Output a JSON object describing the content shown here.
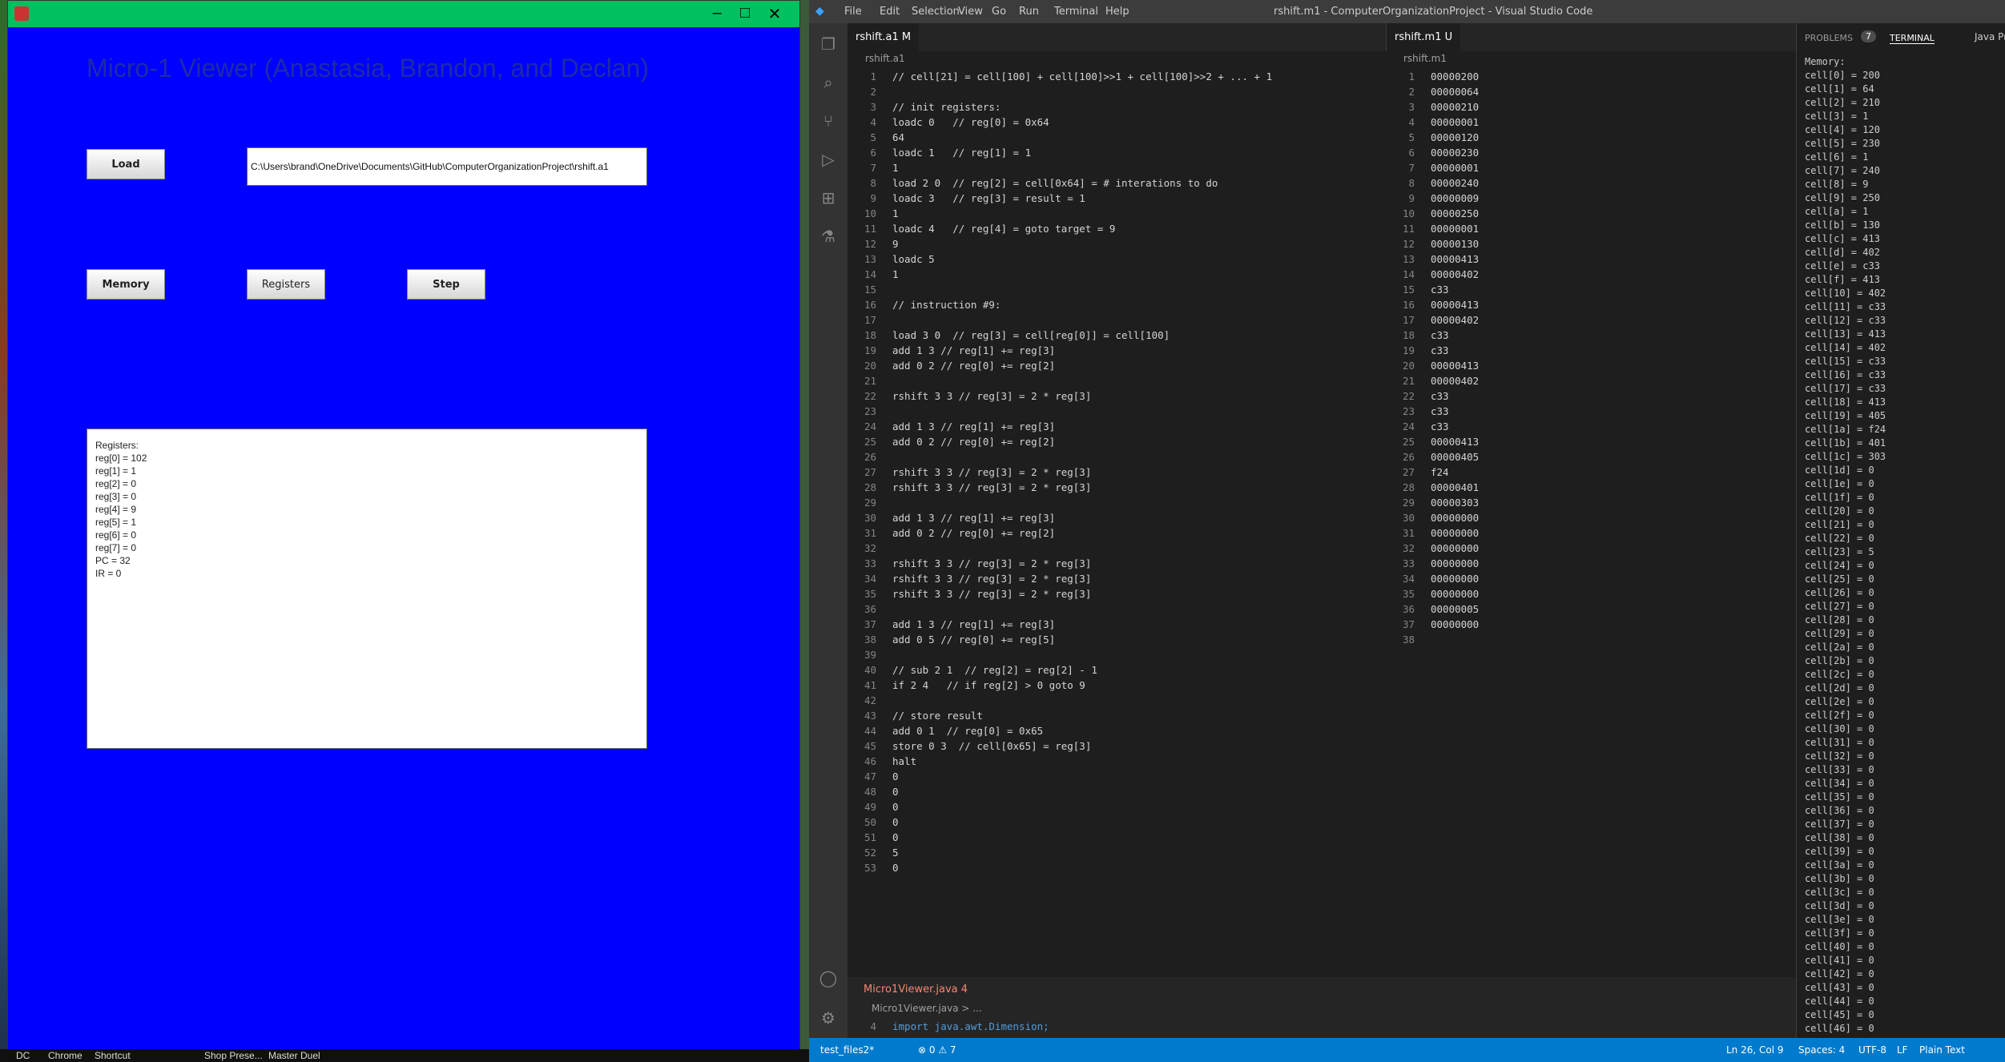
{
  "java_window": {
    "heading": "Micro-1 Viewer (Anastasia, Brandon, and Declan)",
    "buttons": {
      "load": "Load",
      "memory": "Memory",
      "registers": "Registers",
      "step": "Step"
    },
    "path_field": "C:\\Users\\brand\\OneDrive\\Documents\\GitHub\\ComputerOrganizationProject\\rshift.a1",
    "registers_text": [
      "Registers:",
      "reg[0] = 102",
      "reg[1] = 1",
      "reg[2] = 0",
      "reg[3] = 0",
      "reg[4] = 9",
      "reg[5] = 1",
      "reg[6] = 0",
      "reg[7] = 0",
      "PC = 32",
      "IR = 0"
    ]
  },
  "taskbar": [
    "DC",
    "Chrome",
    "Shortcut",
    "Shop Prese...",
    "Master Duel"
  ],
  "vscode": {
    "menu": [
      "File",
      "Edit",
      "Selection",
      "View",
      "Go",
      "Run",
      "Terminal",
      "Help"
    ],
    "title": "rshift.m1 - ComputerOrganizationProject - Visual Studio Code",
    "left_tab": "rshift.a1  M",
    "left_breadcrumb": "rshift.a1",
    "left_code": [
      "// cell[21] = cell[100] + cell[100]>>1 + cell[100]>>2 + ... + 1",
      "",
      "// init registers:",
      "loadc 0   // reg[0] = 0x64",
      "64",
      "loadc 1   // reg[1] = 1",
      "1",
      "load 2 0  // reg[2] = cell[0x64] = # interations to do",
      "loadc 3   // reg[3] = result = 1",
      "1",
      "loadc 4   // reg[4] = goto target = 9",
      "9",
      "loadc 5",
      "1",
      "",
      "// instruction #9:",
      "",
      "load 3 0  // reg[3] = cell[reg[0]] = cell[100]",
      "add 1 3 // reg[1] += reg[3]",
      "add 0 2 // reg[0] += reg[2]",
      "",
      "rshift 3 3 // reg[3] = 2 * reg[3]",
      "",
      "add 1 3 // reg[1] += reg[3]",
      "add 0 2 // reg[0] += reg[2]",
      "",
      "rshift 3 3 // reg[3] = 2 * reg[3]",
      "rshift 3 3 // reg[3] = 2 * reg[3]",
      "",
      "add 1 3 // reg[1] += reg[3]",
      "add 0 2 // reg[0] += reg[2]",
      "",
      "rshift 3 3 // reg[3] = 2 * reg[3]",
      "rshift 3 3 // reg[3] = 2 * reg[3]",
      "rshift 3 3 // reg[3] = 2 * reg[3]",
      "",
      "add 1 3 // reg[1] += reg[3]",
      "add 0 5 // reg[0] += reg[5]",
      "",
      "// sub 2 1  // reg[2] = reg[2] - 1",
      "if 2 4   // if reg[2] > 0 goto 9",
      "",
      "// store result",
      "add 0 1  // reg[0] = 0x65",
      "store 0 3  // cell[0x65] = reg[3]",
      "halt",
      "0",
      "0",
      "0",
      "0",
      "0",
      "5",
      "0"
    ],
    "right_tab": "rshift.m1  U",
    "right_breadcrumb": "rshift.m1",
    "right_code": [
      "00000200",
      "00000064",
      "00000210",
      "00000001",
      "00000120",
      "00000230",
      "00000001",
      "00000240",
      "00000009",
      "00000250",
      "00000001",
      "00000130",
      "00000413",
      "00000402",
      "c33",
      "00000413",
      "00000402",
      "c33",
      "c33",
      "00000413",
      "00000402",
      "c33",
      "c33",
      "c33",
      "00000413",
      "00000405",
      "f24",
      "00000401",
      "00000303",
      "00000000",
      "00000000",
      "00000000",
      "00000000",
      "00000000",
      "00000000",
      "00000005",
      "00000000",
      ""
    ],
    "panel_tabs": {
      "problems": "PROBLEMS",
      "problems_count": "7",
      "terminal": "TERMINAL",
      "console": "Java Process Console"
    },
    "memory_output": [
      "Memory:",
      "cell[0] = 200",
      "cell[1] = 64",
      "cell[2] = 210",
      "cell[3] = 1",
      "cell[4] = 120",
      "cell[5] = 230",
      "cell[6] = 1",
      "cell[7] = 240",
      "cell[8] = 9",
      "cell[9] = 250",
      "cell[a] = 1",
      "cell[b] = 130",
      "cell[c] = 413",
      "cell[d] = 402",
      "cell[e] = c33",
      "cell[f] = 413",
      "cell[10] = 402",
      "cell[11] = c33",
      "cell[12] = c33",
      "cell[13] = 413",
      "cell[14] = 402",
      "cell[15] = c33",
      "cell[16] = c33",
      "cell[17] = c33",
      "cell[18] = 413",
      "cell[19] = 405",
      "cell[1a] = f24",
      "cell[1b] = 401",
      "cell[1c] = 303",
      "cell[1d] = 0",
      "cell[1e] = 0",
      "cell[1f] = 0",
      "cell[20] = 0",
      "cell[21] = 0",
      "cell[22] = 0",
      "cell[23] = 5",
      "cell[24] = 0",
      "cell[25] = 0",
      "cell[26] = 0",
      "cell[27] = 0",
      "cell[28] = 0",
      "cell[29] = 0",
      "cell[2a] = 0",
      "cell[2b] = 0",
      "cell[2c] = 0",
      "cell[2d] = 0",
      "cell[2e] = 0",
      "cell[2f] = 0",
      "cell[30] = 0",
      "cell[31] = 0",
      "cell[32] = 0",
      "cell[33] = 0",
      "cell[34] = 0",
      "cell[35] = 0",
      "cell[36] = 0",
      "cell[37] = 0",
      "cell[38] = 0",
      "cell[39] = 0",
      "cell[3a] = 0",
      "cell[3b] = 0",
      "cell[3c] = 0",
      "cell[3d] = 0",
      "cell[3e] = 0",
      "cell[3f] = 0",
      "cell[40] = 0",
      "cell[41] = 0",
      "cell[42] = 0",
      "cell[43] = 0",
      "cell[44] = 0",
      "cell[45] = 0",
      "cell[46] = 0"
    ],
    "bottom_tab": "Micro1Viewer.java  4",
    "bottom_breadcrumb": "Micro1Viewer.java > ...",
    "bottom_code_line_num": "4",
    "bottom_code": "import java.awt.Dimension;",
    "status": {
      "branch": "test_files2*",
      "problems": "⊗ 0 ⚠ 7",
      "position": "Ln 26, Col 9",
      "spaces": "Spaces: 4",
      "encoding": "UTF-8",
      "eol": "LF",
      "language": "Plain Text"
    }
  }
}
